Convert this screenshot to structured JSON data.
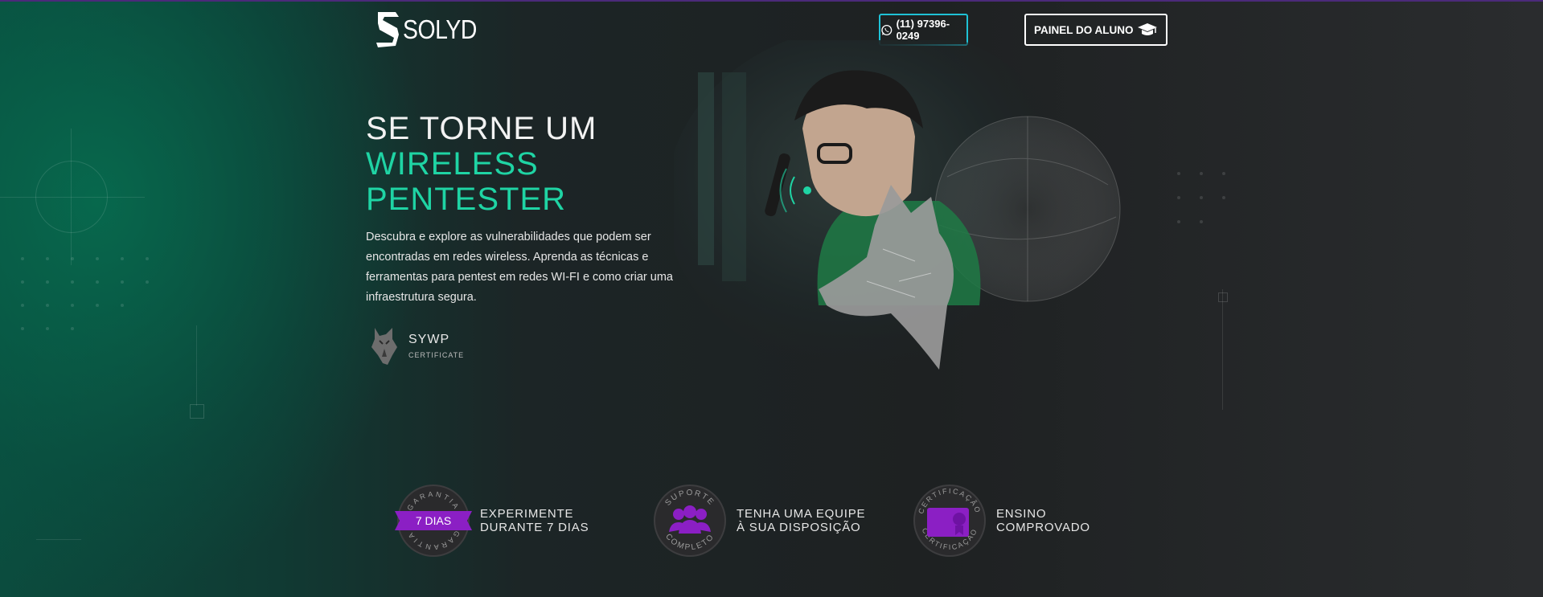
{
  "header": {
    "logo_text": "SOLYD",
    "phone": "(11) 97396-0249",
    "panel_label": "PAINEL DO ALUNO"
  },
  "hero": {
    "title_line1": "SE TORNE UM",
    "title_line2": "WIRELESS",
    "title_line3": "PENTESTER",
    "description": "Descubra e explore as vulnerabilidades que podem ser encontradas em redes wireless. Aprenda as técnicas e ferramentas para pentest em redes WI-FI e como criar uma infraestrutura segura.",
    "cert_name": "SYWP",
    "cert_label": "CERTIFICATE"
  },
  "features": [
    {
      "badge_ring_text": "GARANTIA",
      "badge_center_text": "7 DIAS",
      "line1": "EXPERIMENTE",
      "line2": "DURANTE 7 DIAS"
    },
    {
      "badge_ring_top": "SUPORTE",
      "badge_ring_bottom": "COMPLETO",
      "line1": "TENHA UMA EQUIPE",
      "line2": "À SUA DISPOSIÇÃO"
    },
    {
      "badge_ring_text": "CERTIFICAÇÃO",
      "line1": "ENSINO",
      "line2": "COMPROVADO"
    }
  ],
  "colors": {
    "accent_teal": "#1fd4a4",
    "phone_border": "#1fc2d6",
    "badge_purple": "#8b1fc4",
    "background": "#1e2122"
  },
  "icons": [
    "logo-s-icon",
    "whatsapp-icon",
    "graduation-cap-icon",
    "wolf-icon",
    "team-icon",
    "certificate-icon"
  ]
}
